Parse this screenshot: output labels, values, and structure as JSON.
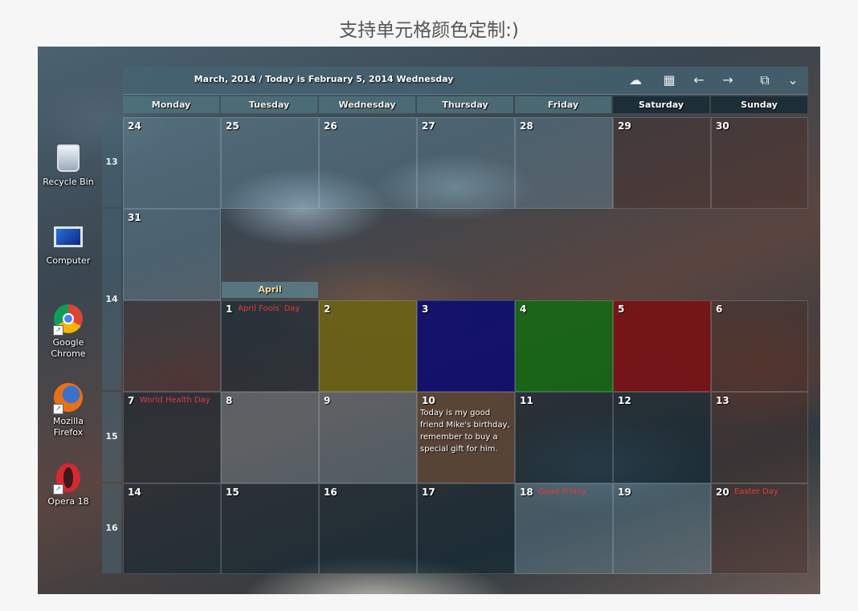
{
  "caption": "支持单元格颜色定制:)",
  "desktop_icons": [
    {
      "label": "Recycle Bin",
      "icon": "recycle-bin-icon"
    },
    {
      "label": "Computer",
      "icon": "computer-icon"
    },
    {
      "label": "Google Chrome",
      "icon": "chrome-icon"
    },
    {
      "label": "Mozilla Firefox",
      "icon": "firefox-icon"
    },
    {
      "label": "Opera 18",
      "icon": "opera-icon"
    }
  ],
  "calendar": {
    "title": "March, 2014 / Today is February 5, 2014 Wednesday",
    "toolbar": [
      "cloud-icon",
      "calendar-icon",
      "arrow-left-icon",
      "arrow-right-icon",
      "window-icon",
      "chevron-down-icon"
    ],
    "day_headers": [
      "Monday",
      "Tuesday",
      "Wednesday",
      "Thursday",
      "Friday",
      "Saturday",
      "Sunday"
    ],
    "week_numbers": [
      "13",
      "14",
      "15",
      "16"
    ],
    "month_tab": "April",
    "days": {
      "d24": "24",
      "d25": "25",
      "d26": "26",
      "d27": "27",
      "d28": "28",
      "d29": "29",
      "d30": "30",
      "d31": "31",
      "a1": "1",
      "a2": "2",
      "a3": "3",
      "a4": "4",
      "a5": "5",
      "a6": "6",
      "a7": "7",
      "a8": "8",
      "a9": "9",
      "a10": "10",
      "a11": "11",
      "a12": "12",
      "a13": "13",
      "a14": "14",
      "a15": "15",
      "a16": "16",
      "a17": "17",
      "a18": "18",
      "a19": "19",
      "a20": "20"
    },
    "holidays": {
      "a1": "April Fools' Day",
      "a7": "World Health Day",
      "a18": "Good Friday",
      "a20": "Easter Day"
    },
    "note_a10": "Today is my good friend Mike's birthday, remember to buy a special gift for him.",
    "custom_colors": {
      "a2": "#6b6412",
      "a3": "#0c0c6e",
      "a4": "#106a12",
      "a5": "#7a0e12",
      "a10": "#5a4535"
    }
  }
}
